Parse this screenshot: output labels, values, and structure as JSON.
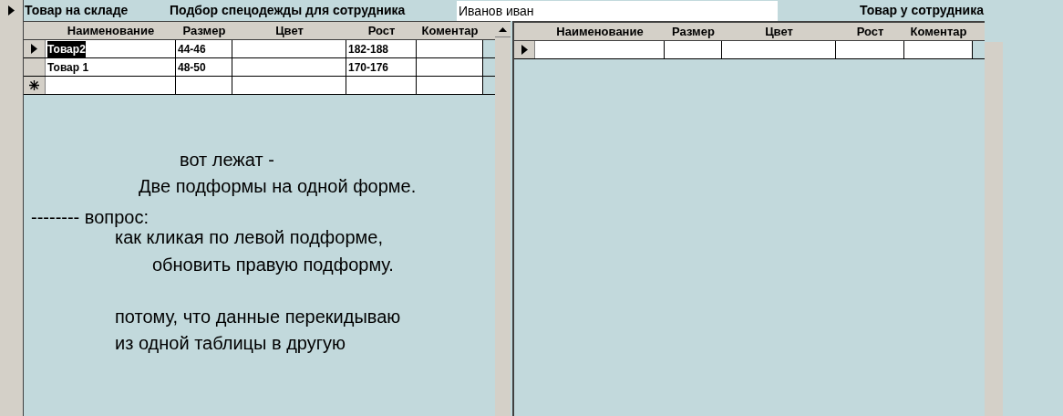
{
  "header": {
    "left_title": "Товар на складе",
    "center_title": "Подбор спецодежды для сотрудника",
    "employee_field": {
      "value": "Иванов иван"
    },
    "right_title": "Товар у сотрудника"
  },
  "left_grid": {
    "columns": [
      "Наименование",
      "Размер",
      "Цвет",
      "Рост",
      "Коментар"
    ],
    "rows": [
      {
        "cells": [
          "Товар2",
          "44-46",
          "",
          "182-188",
          ""
        ],
        "current": true
      },
      {
        "cells": [
          "Товар 1",
          "48-50",
          "",
          "170-176",
          ""
        ],
        "current": false
      }
    ],
    "new_row": true
  },
  "notes": [
    "вот лежат -",
    "Две подформы на одной форме.",
    "-------- вопрос:",
    "как кликая по левой подформе,",
    "обновить правую подформу.",
    "потому, что данные перекидываю",
    "из одной таблицы в другую"
  ],
  "right_grid": {
    "columns": [
      "Наименование",
      "Размер",
      "Цвет",
      "Рост",
      "Коментар"
    ],
    "rows": [
      {
        "cells": [
          "",
          "",
          "",
          "",
          ""
        ],
        "current": true
      }
    ],
    "new_row": false
  }
}
